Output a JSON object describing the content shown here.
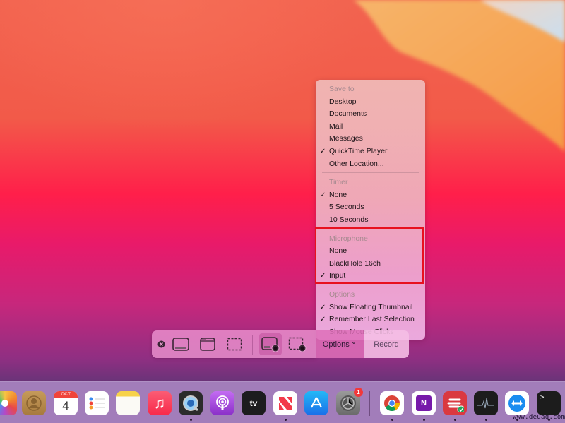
{
  "menu": {
    "sections": [
      {
        "header": "Save to",
        "items": [
          {
            "label": "Desktop",
            "checked": false
          },
          {
            "label": "Documents",
            "checked": false
          },
          {
            "label": "Mail",
            "checked": false
          },
          {
            "label": "Messages",
            "checked": false
          },
          {
            "label": "QuickTime Player",
            "checked": true
          },
          {
            "label": "Other Location...",
            "checked": false
          }
        ]
      },
      {
        "header": "Timer",
        "items": [
          {
            "label": "None",
            "checked": true
          },
          {
            "label": "5 Seconds",
            "checked": false
          },
          {
            "label": "10 Seconds",
            "checked": false
          }
        ]
      },
      {
        "header": "Microphone",
        "highlighted": true,
        "items": [
          {
            "label": "None",
            "checked": false
          },
          {
            "label": "BlackHole 16ch",
            "checked": false
          },
          {
            "label": "Input",
            "checked": true
          }
        ]
      },
      {
        "header": "Options",
        "items": [
          {
            "label": "Show Floating Thumbnail",
            "checked": true
          },
          {
            "label": "Remember Last Selection",
            "checked": true
          },
          {
            "label": "Show Mouse Clicks",
            "checked": false
          }
        ]
      }
    ],
    "checkmark": "✓",
    "highlight_color": "#e8101e"
  },
  "toolbar": {
    "close_icon": "close-circle-icon",
    "tools": [
      {
        "name": "capture-entire-screen",
        "icon": "screen-icon"
      },
      {
        "name": "capture-selected-window",
        "icon": "window-icon"
      },
      {
        "name": "capture-selected-portion",
        "icon": "dashed-rect-icon"
      },
      {
        "name": "record-entire-screen",
        "icon": "screen-record-icon",
        "selected": true
      },
      {
        "name": "record-selected-portion",
        "icon": "dashed-record-icon"
      }
    ],
    "options_label": "Options",
    "options_chevron": "⌄",
    "record_label": "Record"
  },
  "dock": {
    "apps": [
      {
        "name": "Photos",
        "running": false
      },
      {
        "name": "Contacts",
        "running": false
      },
      {
        "name": "Calendar",
        "running": false,
        "month": "OCT",
        "day": "4"
      },
      {
        "name": "Reminders",
        "running": false
      },
      {
        "name": "Notes",
        "running": false
      },
      {
        "name": "Music",
        "running": false
      },
      {
        "name": "QuickTime Player",
        "running": true
      },
      {
        "name": "Podcasts",
        "running": false
      },
      {
        "name": "Apple TV",
        "running": false,
        "label": "tv"
      },
      {
        "name": "News",
        "running": true
      },
      {
        "name": "App Store",
        "running": false
      },
      {
        "name": "System Preferences",
        "running": false,
        "badge": "1"
      },
      {
        "name": "Google Chrome",
        "running": true
      },
      {
        "name": "OneNote",
        "running": true,
        "label": "N"
      },
      {
        "name": "ExpressVPN",
        "running": true
      },
      {
        "name": "Activity Monitor",
        "running": true
      },
      {
        "name": "TeamViewer",
        "running": true
      },
      {
        "name": "Terminal",
        "running": true,
        "label": ">_"
      }
    ]
  },
  "watermark": "www.deuaq.com"
}
